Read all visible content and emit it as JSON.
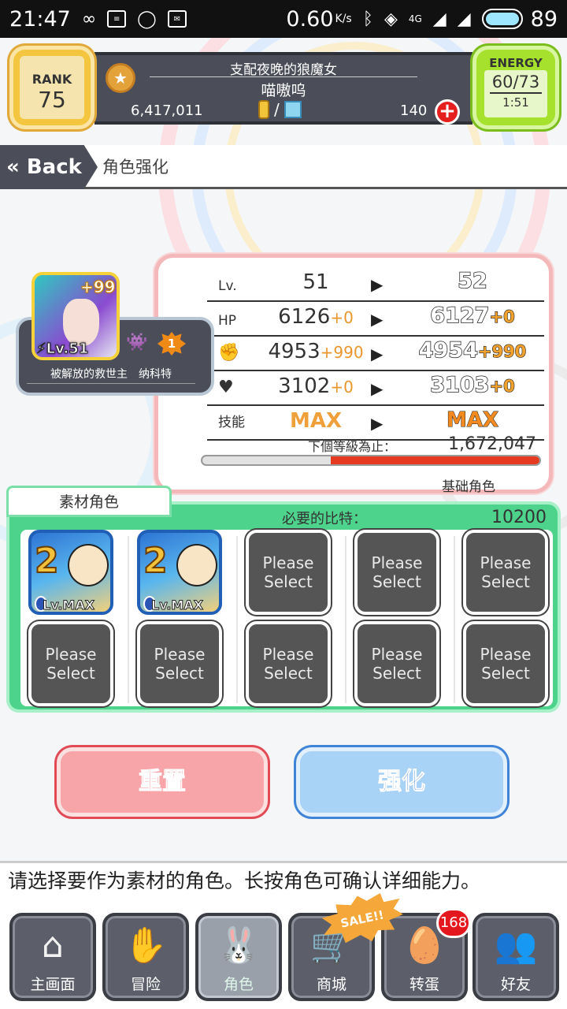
{
  "status_bar": {
    "time": "21:47",
    "speed": "0.60",
    "speed_unit": "K/s",
    "network": "4G",
    "battery": "89"
  },
  "header": {
    "rank_label": "RANK",
    "rank_value": "75",
    "title": "支配夜晚的狼魔女",
    "player_name": "喵嗷呜",
    "money": "6,417,011",
    "currency_sep": "/",
    "gems": "140",
    "energy_label": "ENERGY",
    "energy_value": "60/73",
    "energy_timer": "1:51"
  },
  "nav_bar": {
    "back_label": "Back",
    "breadcrumb": "角色强化"
  },
  "character": {
    "level_tag": "Lv.51",
    "plus_tag": "+99",
    "rank_badge": "1",
    "name": "被解放的救世主　纳科特"
  },
  "stats": {
    "rows": [
      {
        "label": "Lv.",
        "current": "51",
        "current_add": "",
        "next": "52",
        "next_add": ""
      },
      {
        "label": "HP",
        "current": "6126",
        "current_add": "+0",
        "next": "6127",
        "next_add": "+0"
      },
      {
        "label": "",
        "current": "4953",
        "current_add": "+990",
        "next": "4954",
        "next_add": "+990"
      },
      {
        "label": "",
        "current": "3102",
        "current_add": "+0",
        "next": "3103",
        "next_add": "+0"
      },
      {
        "label": "技能",
        "current": "MAX",
        "current_add": "",
        "next": "MAX",
        "next_add": ""
      }
    ],
    "next_level_label": "下個等級為止：",
    "next_level_value": "1,672,047",
    "exp_fraction": 0.62,
    "base_label": "基础角色"
  },
  "materials": {
    "tab_label": "素材角色",
    "required_label": "必要的比特：",
    "required_value": "10200",
    "filled_level": "Lv.MAX",
    "select_label_1": "Please",
    "select_label_2": "Select"
  },
  "actions": {
    "reset_label": "重置",
    "enhance_label": "强化"
  },
  "hint": "请选择要作为素材的角色。长按角色可确认详细能力。",
  "bottom_nav": {
    "items": [
      {
        "label": "主画面",
        "icon": "home-icon"
      },
      {
        "label": "冒险",
        "icon": "handshake-icon"
      },
      {
        "label": "角色",
        "icon": "rabbit-icon"
      },
      {
        "label": "商城",
        "icon": "cart-icon"
      },
      {
        "label": "转蛋",
        "icon": "egg-icon"
      },
      {
        "label": "好友",
        "icon": "friends-icon"
      }
    ],
    "sale_label": "SALE!!",
    "egg_badge": "168"
  },
  "colors": {
    "accent_red": "#e53a1f",
    "panel_green": "#4dd38b",
    "rank_gold": "#f4c640",
    "energy_green": "#a5e12d"
  }
}
